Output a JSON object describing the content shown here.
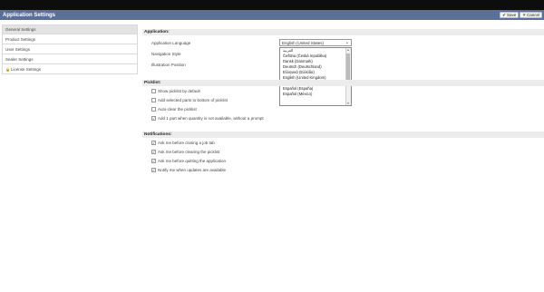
{
  "app": {
    "title": "Application Settings"
  },
  "toolbar": {
    "save_label": "Save",
    "close_label": "Cancel"
  },
  "sidebar": {
    "items": [
      {
        "label": "General Settings",
        "active": true
      },
      {
        "label": "Product Settings"
      },
      {
        "label": "User Settings"
      },
      {
        "label": "Sealer Settings"
      },
      {
        "label": "License Settings",
        "icon": "lock-icon"
      }
    ]
  },
  "application": {
    "section": "Application:",
    "language_label": "Application Language",
    "language_value": "English (United States)",
    "nav_label": "Navigation Style",
    "illustration_label": "Illustration Position",
    "language_options": [
      "العربية",
      "Čeština (Česká republika)",
      "Dansk (Danmark)",
      "Deutsch (Deutschland)",
      "Ελληνικά (Ελλάδα)",
      "English (United Kingdom)",
      "English (United States)",
      "Español (España)",
      "Español (México)"
    ]
  },
  "picklist": {
    "section": "Picklist:",
    "items": [
      {
        "label": "Show picklist by default",
        "checked": false
      },
      {
        "label": "Add selected parts to bottom of picklist",
        "checked": false
      },
      {
        "label": "Auto-clear the picklist",
        "checked": false
      },
      {
        "label": "Add 1 part when quantity is not available, without a prompt",
        "checked": true
      }
    ]
  },
  "notifications": {
    "section": "Notifications:",
    "items": [
      {
        "label": "Ask me before closing a job tab",
        "checked": true
      },
      {
        "label": "Ask me before clearing the picklist",
        "checked": true
      },
      {
        "label": "Ask me before quitting the application",
        "checked": true
      },
      {
        "label": "Notify me when updates are available",
        "checked": true
      }
    ]
  }
}
